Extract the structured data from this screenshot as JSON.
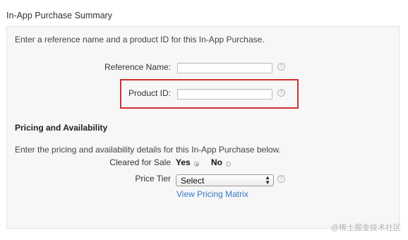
{
  "section_title": "In-App Purchase Summary",
  "intro_text": "Enter a reference name and a product ID for this In-App Purchase.",
  "fields": {
    "reference_name_label": "Reference Name:",
    "reference_name_value": "",
    "product_id_label": "Product ID:",
    "product_id_value": "",
    "help_glyph": "?"
  },
  "pricing": {
    "heading": "Pricing and Availability",
    "description": "Enter the pricing and availability details for this In-App Purchase below.",
    "cleared_for_sale_label": "Cleared for Sale",
    "yes_label": "Yes",
    "no_label": "No",
    "cleared_for_sale_selected": "Yes",
    "price_tier_label": "Price Tier",
    "price_tier_value": "Select",
    "view_pricing_matrix_link": "View Pricing Matrix"
  },
  "watermark": "@稀土掘金技术社区",
  "colors": {
    "highlight_border": "#d0312d",
    "link": "#3478c4",
    "panel_bg": "#f7f7f7"
  },
  "icons": [
    "help-icon",
    "radio-selected",
    "radio-unselected",
    "select-arrows-icon"
  ]
}
